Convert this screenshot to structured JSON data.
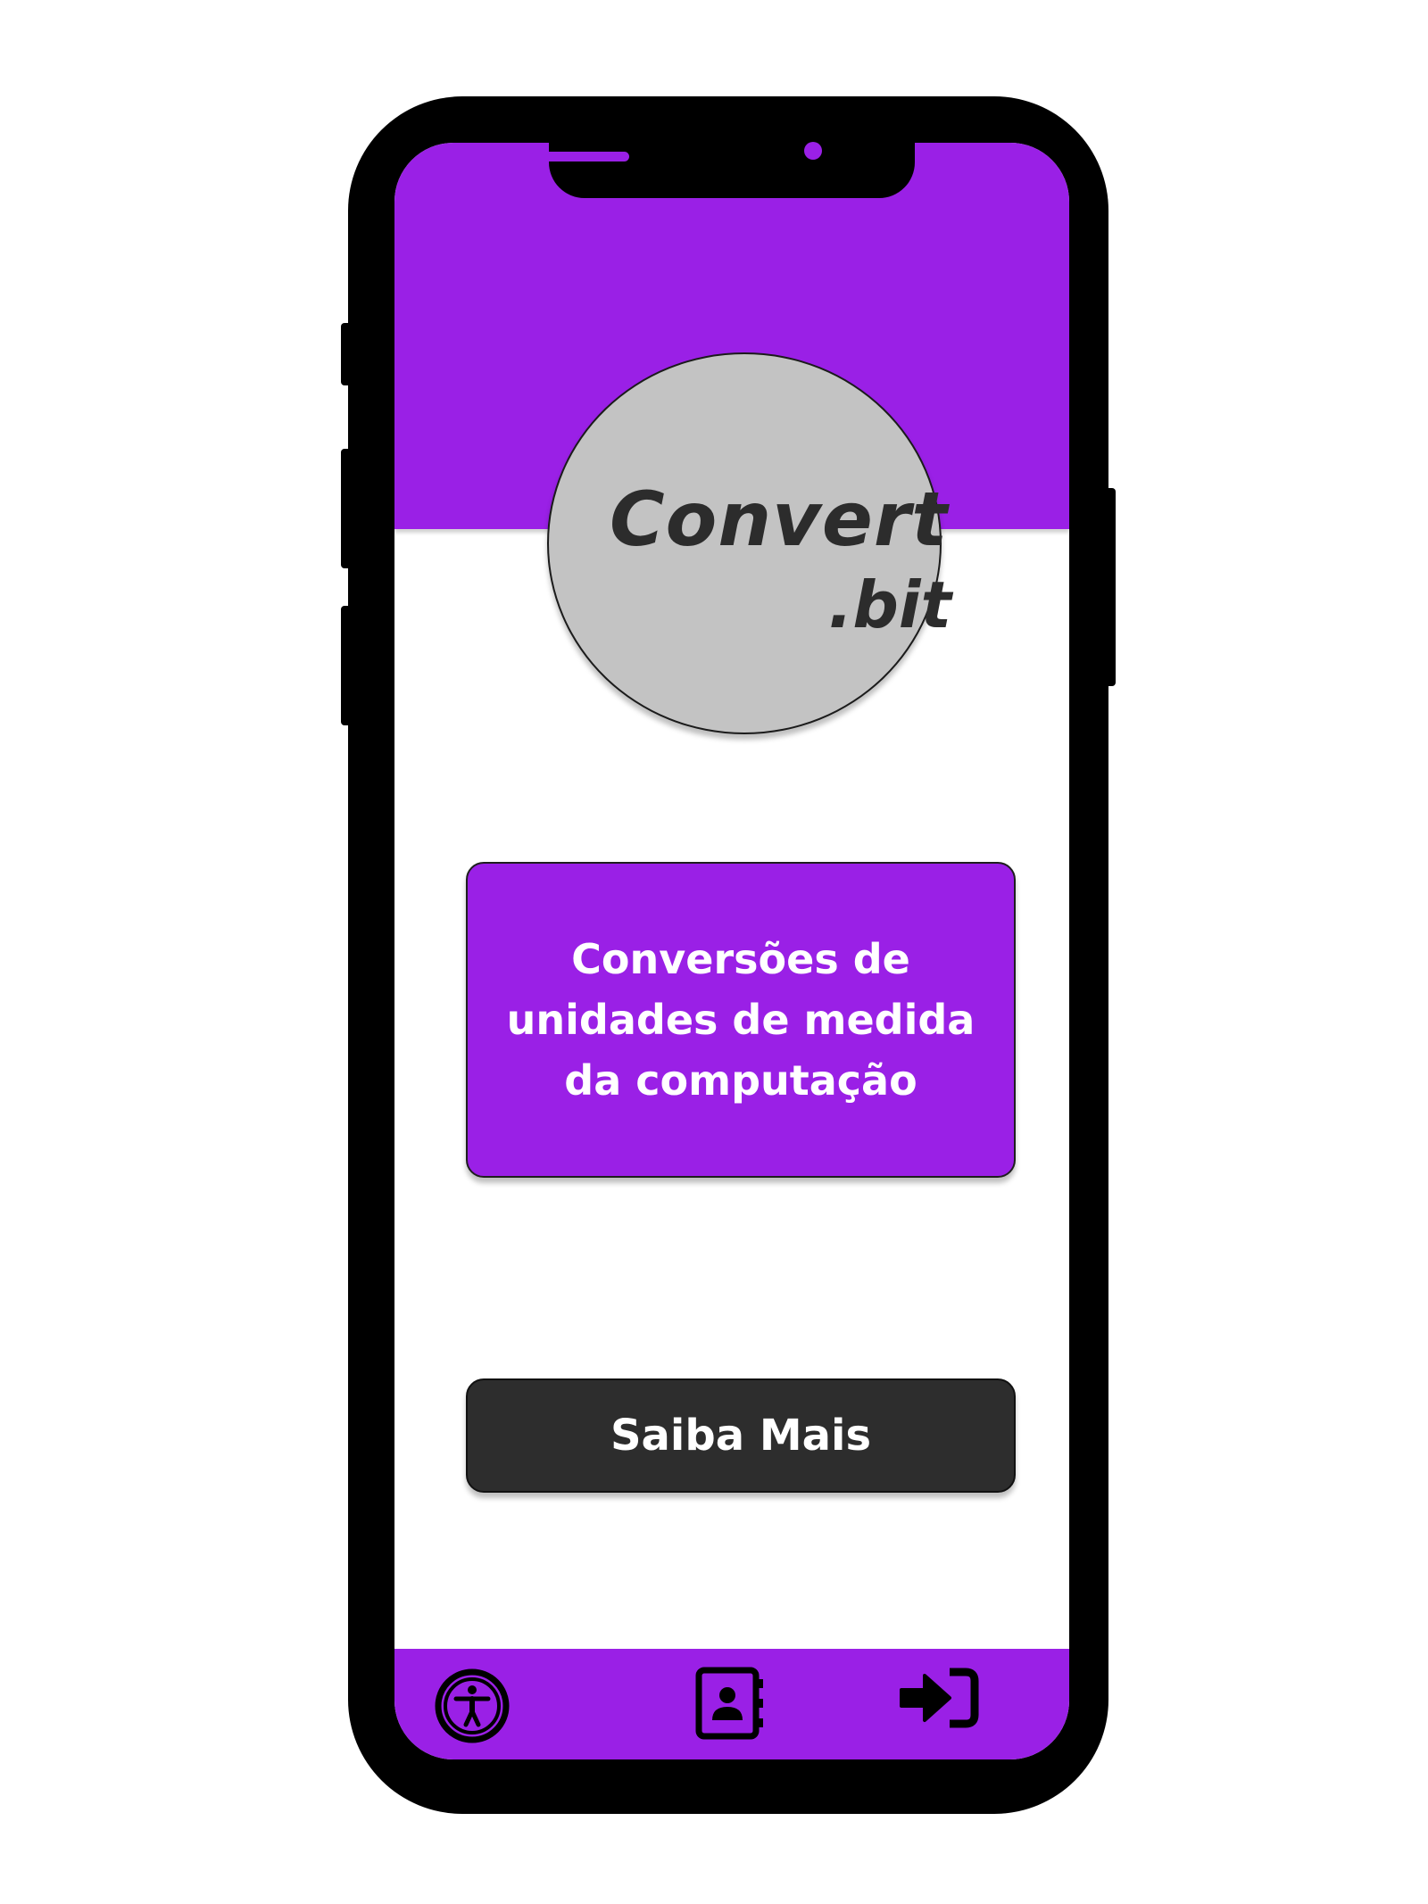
{
  "app": {
    "logo_main": "Convert",
    "logo_sub": ".bit"
  },
  "main": {
    "info_card_text": "Conversões de\nunidades de medida\nda computação",
    "more_button_label": "Saiba Mais"
  },
  "bottom_nav": {
    "items": [
      {
        "icon": "accessibility-icon"
      },
      {
        "icon": "contacts-icon"
      },
      {
        "icon": "login-icon"
      }
    ]
  },
  "colors": {
    "accent": "#9a20e6",
    "frame": "#000000",
    "logo_circle": "#c3c3c3",
    "dark_button": "#2d2d2d"
  }
}
